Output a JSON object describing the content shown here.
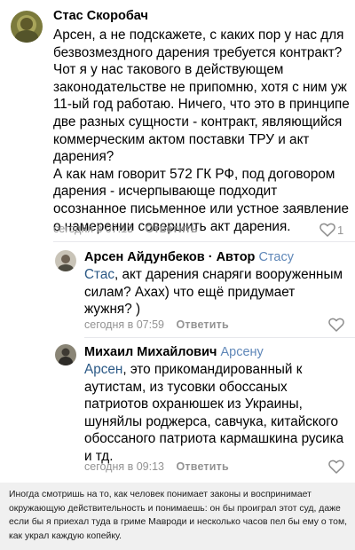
{
  "comments": [
    {
      "author": "Стас Скоробач",
      "text": "Арсен, а не подскажете, с каких пор у нас для\nбезвозмездного дарения требуется контракт?\nЧот я у нас такового в действующем\nзаконодательстве не припомню, хотя с ним уж\n11-ый год работаю. Ничего, что это в принципе\nдве разных сущности - контракт, являющийся\nкоммерческим актом поставки ТРУ и акт\nдарения?\nА как нам говорит 572 ГК РФ, под договором\nдарения - исчерпывающе подходит\nосознанное письменное или устное заявление\nо намерении совершить акт дарения.",
      "time": "сегодня в 07:13",
      "reply_label": "Ответить",
      "likes": "1"
    },
    {
      "author": "Арсен Айдунбеков",
      "role": " · Автор",
      "reply_to": "Стасу",
      "mention": "Стас",
      "text": ", акт дарения снаряги  вооруженным\nсилам? Ахах) что ещё придумает\nжужня? )",
      "time": "сегодня в 07:59",
      "reply_label": "Ответить"
    },
    {
      "author": "Михаил Михайлович",
      "reply_to": "Арсену",
      "mention": "Арсен",
      "text": ", это прикомандированный к\nаутистам, из тусовки обоссаных\nпатриотов охранюшек из Украины,\nшуняйлы роджерса, савчука, китайского\nобоссаного патриота кармашкина русика\nи тд.",
      "time": "сегодня в 09:13",
      "reply_label": "Ответить"
    }
  ],
  "caption": "Иногда смотришь на то, как человек понимает законы и воспринимает окружающую действительность и понимаешь: он бы проиграл этот суд, даже если бы я приехал туда в гриме Мавроди и несколько часов пел бы ему о том, как украл каждую копейку.",
  "colors": {
    "link": "#2a5885",
    "meta": "#939393",
    "caption_bg": "#f0f0f0"
  }
}
